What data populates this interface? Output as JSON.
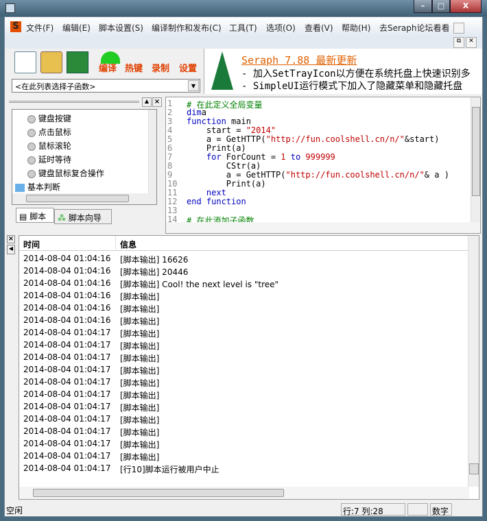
{
  "window": {
    "controls": [
      "–",
      "□",
      "X"
    ]
  },
  "menu": {
    "items": [
      "文件(F)",
      "编辑(E)",
      "脚本设置(S)",
      "编译制作和发布(C)",
      "工具(T)",
      "选项(O)",
      "查看(V)",
      "帮助(H)",
      "去Seraph论坛看看"
    ]
  },
  "toolbar": {
    "buttons": [
      "编译",
      "热键",
      "录制",
      "设置"
    ]
  },
  "combo": {
    "value": "<在此列表选择子函数>"
  },
  "news": {
    "title": "Seraph 7.88 最新更新",
    "lines": [
      "- 加入SetTrayIcon以方便在系统托盘上快速识别多",
      "- SimpleUI运行模式下加入了隐藏菜单和隐藏托盘"
    ]
  },
  "tree": {
    "items": [
      "键盘按键",
      "点击鼠标",
      "鼠标滚轮",
      "延时等待",
      "键盘鼠标复合操作"
    ],
    "folder": "基本判断"
  },
  "lefttabs": [
    "脚本",
    "脚本向导"
  ],
  "editor": {
    "lines": [
      [
        [
          "cm",
          "# 在此定义全局变量"
        ]
      ],
      [
        [
          "kw",
          "dim"
        ],
        [
          "",
          "a"
        ]
      ],
      [
        [
          "kw",
          "function"
        ],
        [
          "",
          " main"
        ]
      ],
      [
        [
          "",
          "    start = "
        ],
        [
          "str",
          "\"2014\""
        ]
      ],
      [
        [
          "",
          "    a = GetHTTP("
        ],
        [
          "str",
          "\"http://fun.coolshell.cn/n/\""
        ],
        [
          "",
          "&start)"
        ]
      ],
      [
        [
          "",
          "    Print(a)"
        ]
      ],
      [
        [
          "kw",
          "    for"
        ],
        [
          "",
          " ForCount = "
        ],
        [
          "str",
          "1"
        ],
        [
          "kw",
          " to "
        ],
        [
          "str",
          "999999"
        ]
      ],
      [
        [
          "",
          "        CStr(a)"
        ]
      ],
      [
        [
          "",
          "        a = GetHTTP("
        ],
        [
          "str",
          "\"http://fun.coolshell.cn/n/\""
        ],
        [
          "",
          "& a )"
        ]
      ],
      [
        [
          "",
          "        Print(a)"
        ]
      ],
      [
        [
          "kw",
          "    next"
        ]
      ],
      [
        [
          "kw",
          "end function"
        ]
      ],
      [
        [
          "",
          ""
        ]
      ],
      [
        [
          "cm",
          "# 在此添加子函数"
        ]
      ]
    ]
  },
  "log": {
    "headers": [
      "时间",
      "信息"
    ],
    "rows": [
      [
        "2014-08-04 01:04:16",
        "[脚本输出] 16626"
      ],
      [
        "2014-08-04 01:04:16",
        "[脚本输出] 20446"
      ],
      [
        "2014-08-04 01:04:16",
        "[脚本输出] Cool! the next level is \"tree\""
      ],
      [
        "2014-08-04 01:04:16",
        "[脚本输出]"
      ],
      [
        "2014-08-04 01:04:16",
        "[脚本输出]"
      ],
      [
        "2014-08-04 01:04:16",
        "[脚本输出]"
      ],
      [
        "2014-08-04 01:04:17",
        "[脚本输出]"
      ],
      [
        "2014-08-04 01:04:17",
        "[脚本输出]"
      ],
      [
        "2014-08-04 01:04:17",
        "[脚本输出]"
      ],
      [
        "2014-08-04 01:04:17",
        "[脚本输出]"
      ],
      [
        "2014-08-04 01:04:17",
        "[脚本输出]"
      ],
      [
        "2014-08-04 01:04:17",
        "[脚本输出]"
      ],
      [
        "2014-08-04 01:04:17",
        "[脚本输出]"
      ],
      [
        "2014-08-04 01:04:17",
        "[脚本输出]"
      ],
      [
        "2014-08-04 01:04:17",
        "[脚本输出]"
      ],
      [
        "2014-08-04 01:04:17",
        "[脚本输出]"
      ],
      [
        "2014-08-04 01:04:17",
        "[脚本输出]"
      ],
      [
        "2014-08-04 01:04:17",
        "[行10]脚本运行被用户中止"
      ]
    ]
  },
  "status": {
    "state": "空闲",
    "position": "行:7  列:28",
    "mode": "数字"
  }
}
